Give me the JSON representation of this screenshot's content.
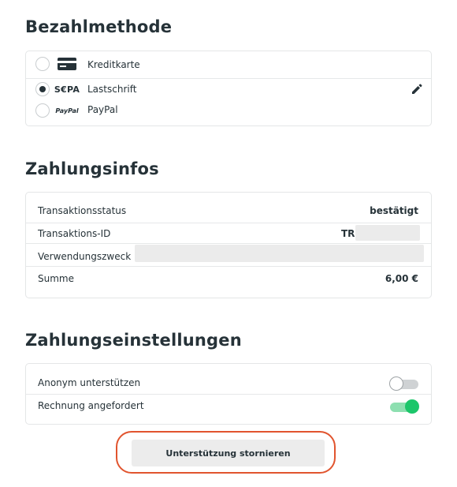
{
  "payment": {
    "title": "Bezahlmethode",
    "methods": [
      {
        "label": "Kreditkarte",
        "icon": "credit-card-icon",
        "selected": false
      },
      {
        "label": "Lastschrift",
        "icon": "sepa-logo",
        "logo_text": "S€PA",
        "selected": true
      },
      {
        "label": "PayPal",
        "icon": "paypal-logo",
        "logo_text": "PayPal",
        "selected": false
      }
    ],
    "edit_icon": "pencil-icon"
  },
  "info": {
    "title": "Zahlungsinfos",
    "rows": [
      {
        "label": "Transaktionsstatus",
        "value": "bestätigt"
      },
      {
        "label": "Transaktions-ID",
        "value": "TR"
      },
      {
        "label": "Verwendungszweck",
        "value": ""
      },
      {
        "label": "Summe",
        "value": "6,00 €"
      }
    ]
  },
  "settings": {
    "title": "Zahlungseinstellungen",
    "items": [
      {
        "label": "Anonym unterstützen",
        "enabled": false
      },
      {
        "label": "Rechnung angefordert",
        "enabled": true
      }
    ]
  },
  "cancel_label": "Unterstützung stornieren",
  "colors": {
    "toggle_on": "#1cc66a",
    "highlight": "#e1542e"
  }
}
